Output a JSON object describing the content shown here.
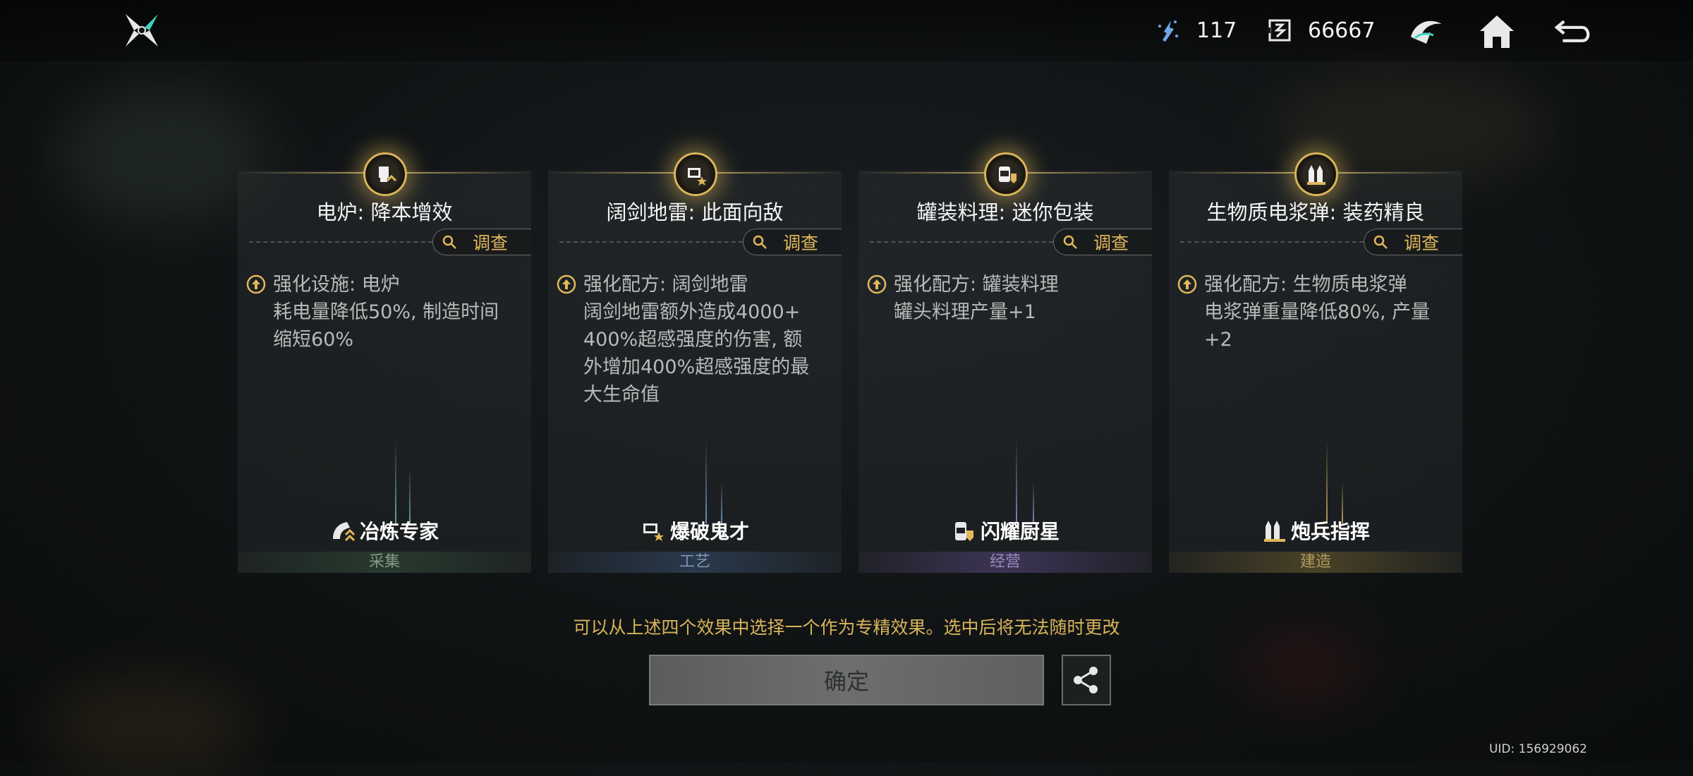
{
  "resources": [
    {
      "name": "energy",
      "icon": "energy-crystal-icon",
      "value": "117"
    },
    {
      "name": "currency",
      "icon": "coin-frame-icon",
      "value": "66667"
    }
  ],
  "top_icons": [
    "faction-emblem-icon",
    "home-icon",
    "back-arrow-icon"
  ],
  "cards": [
    {
      "title": "电炉: 降本增效",
      "invest_label": "调查",
      "desc": [
        "强化设施: 电炉",
        "耗电量降低50%, 制造时间",
        "缩短60%"
      ],
      "tag": "冶炼专家",
      "category": "采集",
      "category_color": "#7f9c83"
    },
    {
      "title": "阔剑地雷: 此面向敌",
      "invest_label": "调查",
      "desc": [
        "强化配方: 阔剑地雷",
        "阔剑地雷额外造成4000+",
        "400%超感强度的伤害, 额",
        "外增加400%超感强度的最",
        "大生命值"
      ],
      "tag": "爆破鬼才",
      "category": "工艺",
      "category_color": "#7f95b4"
    },
    {
      "title": "罐装料理: 迷你包装",
      "invest_label": "调查",
      "desc": [
        "强化配方: 罐装料理",
        "罐头料理产量+1"
      ],
      "tag": "闪耀厨星",
      "category": "经营",
      "category_color": "#9b88bd"
    },
    {
      "title": "生物质电浆弹: 装药精良",
      "invest_label": "调查",
      "desc": [
        "强化配方: 生物质电浆弹",
        "电浆弹重量降低80%, 产量",
        "+2"
      ],
      "tag": "炮兵指挥",
      "category": "建造",
      "category_color": "#b29a5e"
    }
  ],
  "hint": "可以从上述四个效果中选择一个作为专精效果。选中后将无法随时更改",
  "confirm_label": "确定",
  "uid": "UID: 156929062",
  "colors": {
    "gold": "#d9b45a",
    "accent": "#e2b85a"
  }
}
